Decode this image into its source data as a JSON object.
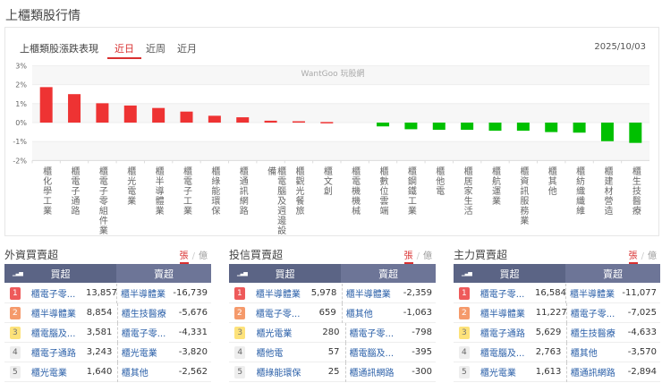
{
  "page": {
    "title": "上櫃類股行情"
  },
  "card": {
    "title": "上櫃類股漲跌表現",
    "tabs": [
      "近日",
      "近周",
      "近月"
    ],
    "date": "2025/10/03",
    "watermark": "WantGoo 玩股網"
  },
  "colors": {
    "up": "#ee3333",
    "down": "#00c000",
    "header": "#5b6485"
  },
  "chart_data": {
    "type": "bar",
    "ylabel": "",
    "xlabel": "",
    "ylim": [
      -2,
      3
    ],
    "yticks": [
      "3%",
      "2%",
      "1%",
      "0%",
      "-1%",
      "-2%"
    ],
    "ytick_values": [
      3,
      2,
      1,
      0,
      -1,
      -2
    ],
    "categories": [
      "櫃化學工業",
      "櫃電子通路",
      "櫃電子零組件業",
      "櫃光電業",
      "櫃半導體業",
      "櫃電子工業",
      "櫃綠能環保",
      "櫃通訊網路",
      "櫃電腦及週邊設備",
      "櫃觀光餐旅",
      "櫃文創",
      "櫃電機機械",
      "櫃數位雲端",
      "櫃鋼鐵工業",
      "櫃他電",
      "櫃居家生活",
      "櫃航運業",
      "櫃資訊服務業",
      "櫃其他",
      "櫃紡織纖維",
      "櫃建材營造",
      "櫃生技醫療"
    ],
    "values": [
      1.87,
      1.5,
      1.02,
      0.9,
      0.77,
      0.58,
      0.36,
      0.28,
      0.1,
      0.07,
      0.03,
      0,
      -0.2,
      -0.35,
      -0.38,
      -0.38,
      -0.43,
      -0.43,
      -0.5,
      -0.53,
      -0.98,
      -1.07
    ]
  },
  "panels": [
    {
      "title": "外資買賣超",
      "unit_on": "張",
      "unit_off": "億",
      "buy_header": "買超",
      "sell_header": "賣超",
      "rows": [
        {
          "rank": "1",
          "buy": "櫃電子零...",
          "buy_val": "13,857",
          "sell": "櫃半導體業",
          "sell_val": "-16,739"
        },
        {
          "rank": "2",
          "buy": "櫃半導體業",
          "buy_val": "8,854",
          "sell": "櫃生技醫療",
          "sell_val": "-5,676"
        },
        {
          "rank": "3",
          "buy": "櫃電腦及...",
          "buy_val": "3,581",
          "sell": "櫃電子零...",
          "sell_val": "-4,331"
        },
        {
          "rank": "4",
          "buy": "櫃電子通路",
          "buy_val": "3,243",
          "sell": "櫃光電業",
          "sell_val": "-3,820"
        },
        {
          "rank": "5",
          "buy": "櫃光電業",
          "buy_val": "1,640",
          "sell": "櫃其他",
          "sell_val": "-2,562"
        }
      ]
    },
    {
      "title": "投信買賣超",
      "unit_on": "張",
      "unit_off": "億",
      "buy_header": "買超",
      "sell_header": "賣超",
      "rows": [
        {
          "rank": "1",
          "buy": "櫃半導體業",
          "buy_val": "5,978",
          "sell": "櫃半導體業",
          "sell_val": "-2,359"
        },
        {
          "rank": "2",
          "buy": "櫃電子零...",
          "buy_val": "659",
          "sell": "櫃其他",
          "sell_val": "-1,063"
        },
        {
          "rank": "3",
          "buy": "櫃光電業",
          "buy_val": "280",
          "sell": "櫃電子零...",
          "sell_val": "-798"
        },
        {
          "rank": "4",
          "buy": "櫃他電",
          "buy_val": "57",
          "sell": "櫃電腦及...",
          "sell_val": "-395"
        },
        {
          "rank": "5",
          "buy": "櫃綠能環保",
          "buy_val": "25",
          "sell": "櫃通訊網路",
          "sell_val": "-300"
        }
      ]
    },
    {
      "title": "主力買賣超",
      "unit_on": "張",
      "unit_off": "億",
      "buy_header": "買超",
      "sell_header": "賣超",
      "rows": [
        {
          "rank": "1",
          "buy": "櫃電子零...",
          "buy_val": "16,584",
          "sell": "櫃半導體業",
          "sell_val": "-11,077"
        },
        {
          "rank": "2",
          "buy": "櫃半導體業",
          "buy_val": "11,227",
          "sell": "櫃電子零...",
          "sell_val": "-7,025"
        },
        {
          "rank": "3",
          "buy": "櫃電子通路",
          "buy_val": "5,629",
          "sell": "櫃生技醫療",
          "sell_val": "-4,633"
        },
        {
          "rank": "4",
          "buy": "櫃電腦及...",
          "buy_val": "2,763",
          "sell": "櫃其他",
          "sell_val": "-3,570"
        },
        {
          "rank": "5",
          "buy": "櫃光電業",
          "buy_val": "1,613",
          "sell": "櫃通訊網路",
          "sell_val": "-2,894"
        }
      ]
    }
  ]
}
